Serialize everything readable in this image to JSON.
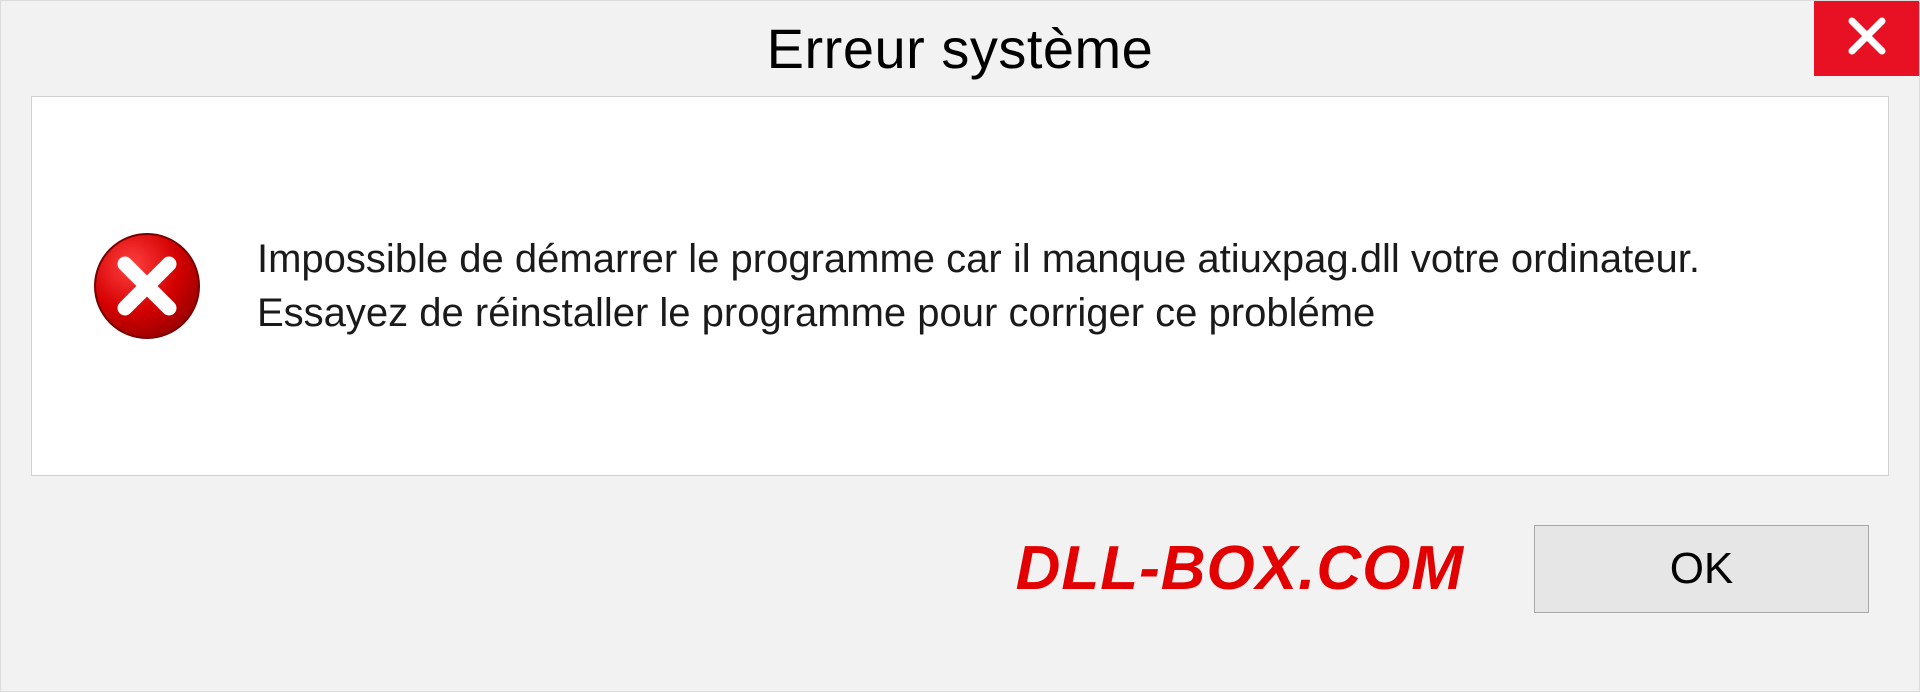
{
  "titlebar": {
    "title": "Erreur système"
  },
  "body": {
    "message": "Impossible de démarrer le programme car il manque atiuxpag.dll votre ordinateur. Essayez de réinstaller le programme pour corriger ce probléme"
  },
  "footer": {
    "brand": "DLL-BOX.COM",
    "ok_label": "OK"
  },
  "colors": {
    "close_bg": "#e81123",
    "error_icon": "#d40000",
    "brand": "#e30000"
  }
}
